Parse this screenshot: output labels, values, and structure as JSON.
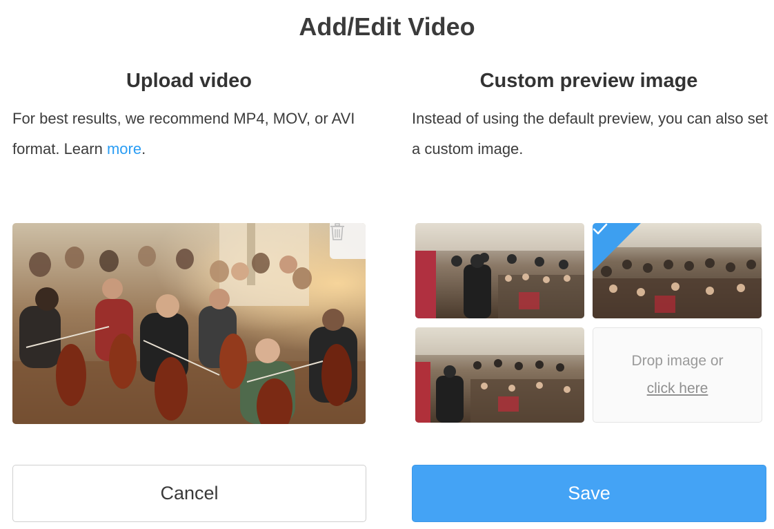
{
  "dialog": {
    "title": "Add/Edit Video"
  },
  "upload": {
    "heading": "Upload video",
    "description_prefix": "For best results, we recommend MP4, MOV, or AVI format. Learn ",
    "learn_link": "more",
    "description_suffix": ".",
    "delete_icon": "trash-icon"
  },
  "preview": {
    "heading": "Custom preview image",
    "description": "Instead of using the default preview, you can also set a custom image.",
    "selected_thumbnail": 2,
    "selected_icon": "check-icon",
    "drop_zone": {
      "text": "Drop image or",
      "link": "click here"
    }
  },
  "actions": {
    "cancel_label": "Cancel",
    "save_label": "Save"
  },
  "colors": {
    "accent": "#44a3f5",
    "link": "#2a9df4"
  }
}
